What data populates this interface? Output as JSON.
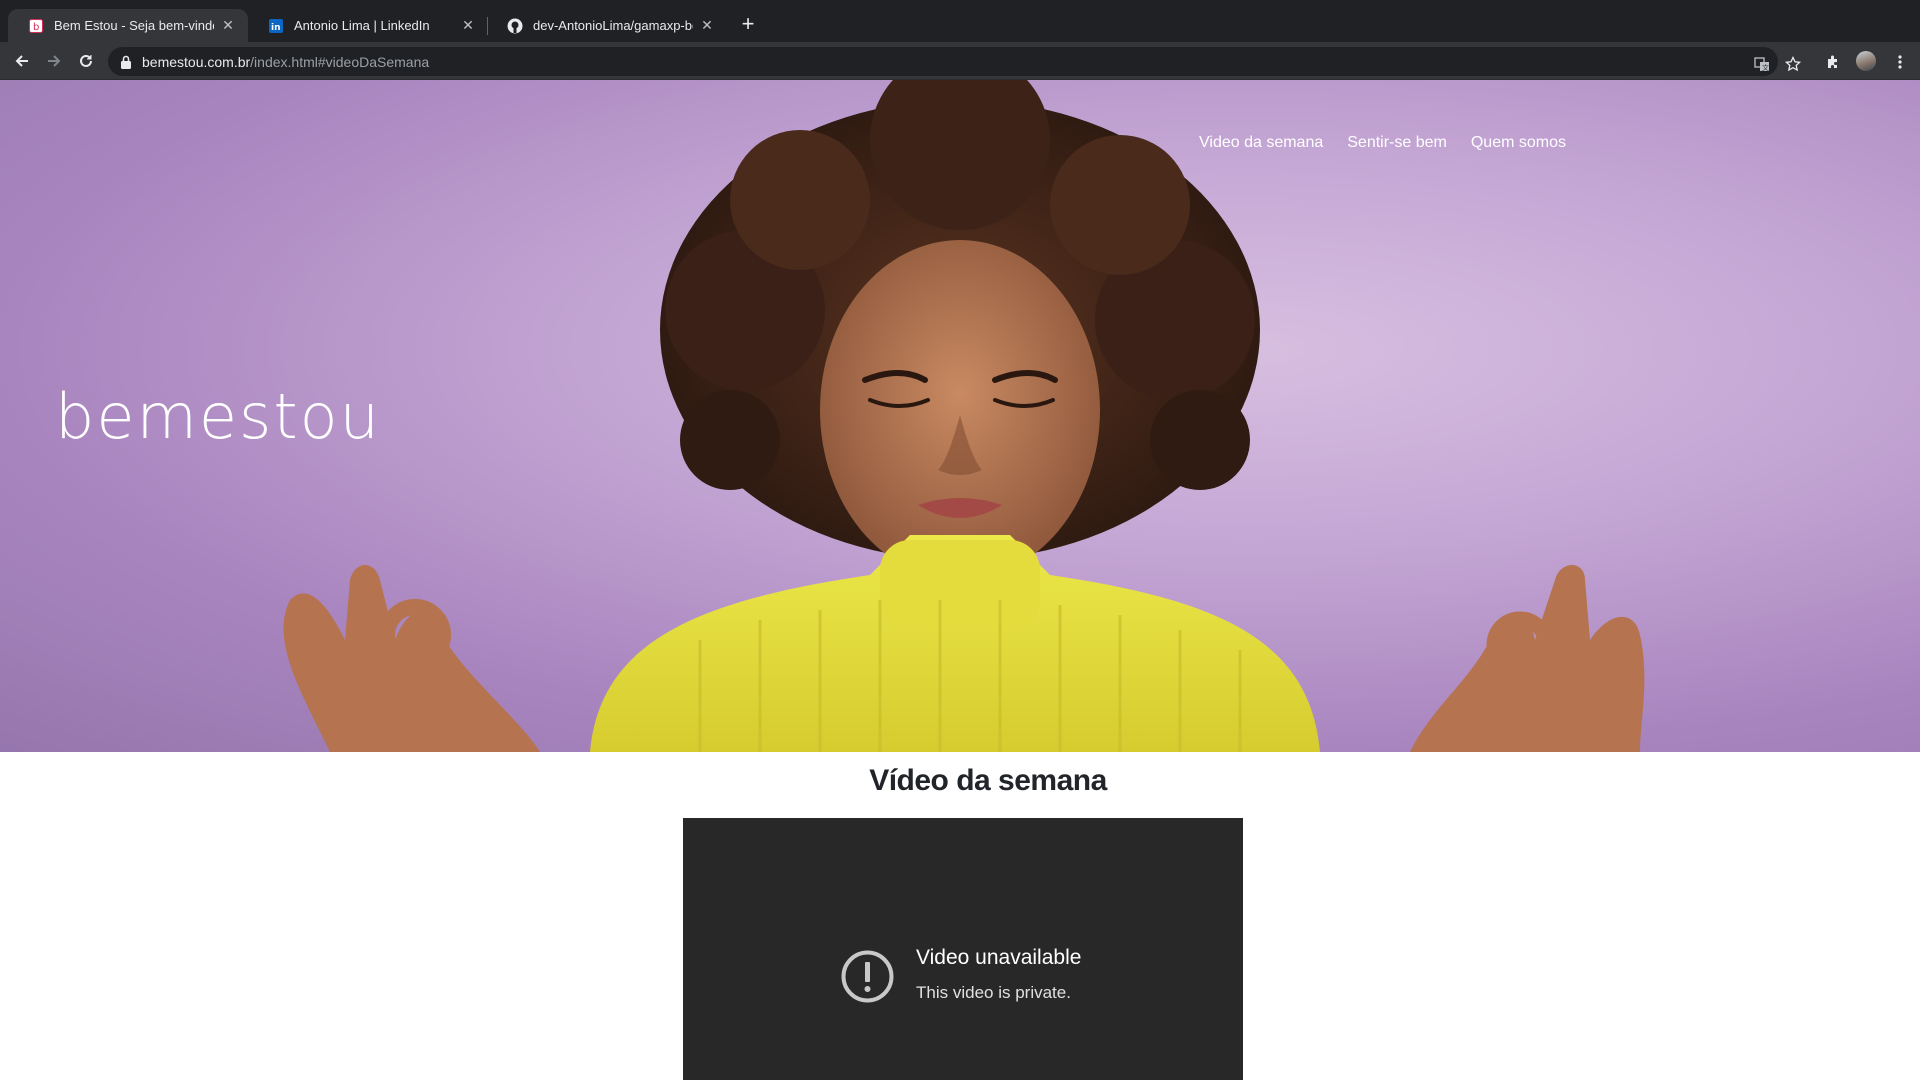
{
  "browser": {
    "tabs": [
      {
        "title": "Bem Estou - Seja bem-vindo",
        "favicon": "bemestou-favicon-icon",
        "active": true
      },
      {
        "title": "Antonio Lima | LinkedIn",
        "favicon": "linkedin-icon",
        "active": false
      },
      {
        "title": "dev-AntonioLima/gamaxp-bem",
        "favicon": "github-icon",
        "active": false
      }
    ],
    "url": {
      "host": "bemestou.com.br",
      "path": "/index.html#videoDaSemana"
    }
  },
  "page": {
    "logo": "bemestou",
    "nav": [
      "Video da semana",
      "Sentir-se bem",
      "Quem somos"
    ],
    "section_title": "Vídeo da semana",
    "video": {
      "title": "Video unavailable",
      "subtitle": "This video is private."
    }
  },
  "colors": {
    "hero_background": "#c4a6d4",
    "sweater": "#e4dc3c",
    "video_background": "#282828"
  }
}
